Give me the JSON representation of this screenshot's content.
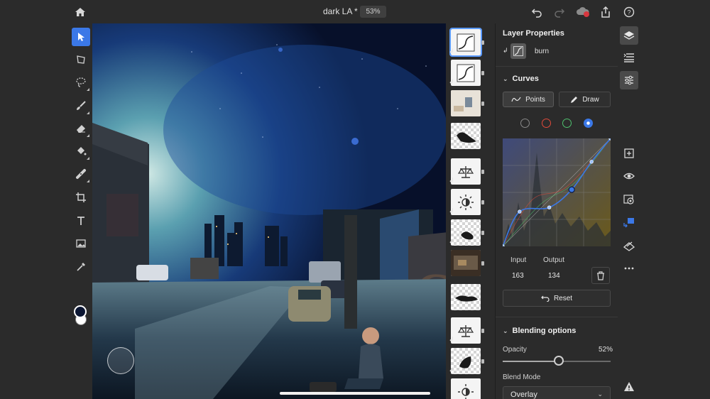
{
  "document": {
    "title": "dark LA *",
    "zoom": "53%"
  },
  "topbar": {
    "icons": [
      "home-icon",
      "undo-icon",
      "redo-icon",
      "cloud-sync-icon",
      "share-icon",
      "help-icon"
    ],
    "notification_count": "1"
  },
  "tools": {
    "items": [
      "select-tool",
      "transform-tool",
      "lasso-tool",
      "brush-tool",
      "eraser-tool",
      "fill-tool",
      "heal-tool",
      "crop-tool",
      "type-tool",
      "place-image-tool",
      "eyedropper-tool"
    ],
    "active": "select-tool",
    "foreground_color": "#0b1633",
    "background_color": "#ffffff"
  },
  "properties": {
    "panel_title": "Layer Properties",
    "layer_name": "burn",
    "curves": {
      "section_title": "Curves",
      "mode_points": "Points",
      "mode_draw": "Draw",
      "active_mode": "Points",
      "channels": [
        {
          "name": "rgb",
          "color": "#8a8a8a"
        },
        {
          "name": "red",
          "color": "#e24a3b"
        },
        {
          "name": "green",
          "color": "#4ec16e"
        },
        {
          "name": "blue",
          "color": "#3b78e7"
        }
      ],
      "active_channel": "blue",
      "input_label": "Input",
      "output_label": "Output",
      "input_value": "163",
      "output_value": "134",
      "reset_label": "Reset",
      "blue_curve_points": [
        [
          0,
          0
        ],
        [
          40,
          82
        ],
        [
          110,
          92
        ],
        [
          163,
          134
        ],
        [
          210,
          200
        ],
        [
          255,
          255
        ]
      ],
      "red_curve_points": [
        [
          0,
          0
        ],
        [
          70,
          110
        ],
        [
          150,
          140
        ],
        [
          255,
          255
        ]
      ],
      "green_curve_points": [
        [
          0,
          0
        ],
        [
          90,
          100
        ],
        [
          170,
          150
        ],
        [
          255,
          255
        ]
      ]
    },
    "blending": {
      "section_title": "Blending options",
      "opacity_label": "Opacity",
      "opacity_value": "52%",
      "opacity_fraction": 0.52,
      "blend_mode_label": "Blend Mode",
      "blend_mode_value": "Overlay"
    }
  },
  "rail": {
    "icons": [
      "layers-icon",
      "layer-stack-icon",
      "adjustments-icon",
      "add-layer-icon",
      "visibility-icon",
      "mask-icon",
      "clip-icon",
      "fx-icon",
      "more-icon",
      "warning-icon"
    ],
    "active": "adjustments-icon"
  },
  "layers": {
    "thumbnails": [
      "curves-adjustment",
      "curves-adjustment",
      "photo-layer",
      "brush-mask",
      "balance-adjustment",
      "brightness-adjustment",
      "brush-mask",
      "photo-layer",
      "brush-mask",
      "balance-adjustment",
      "brush-mask",
      "brightness-adjustment"
    ],
    "selected_index": 0
  }
}
